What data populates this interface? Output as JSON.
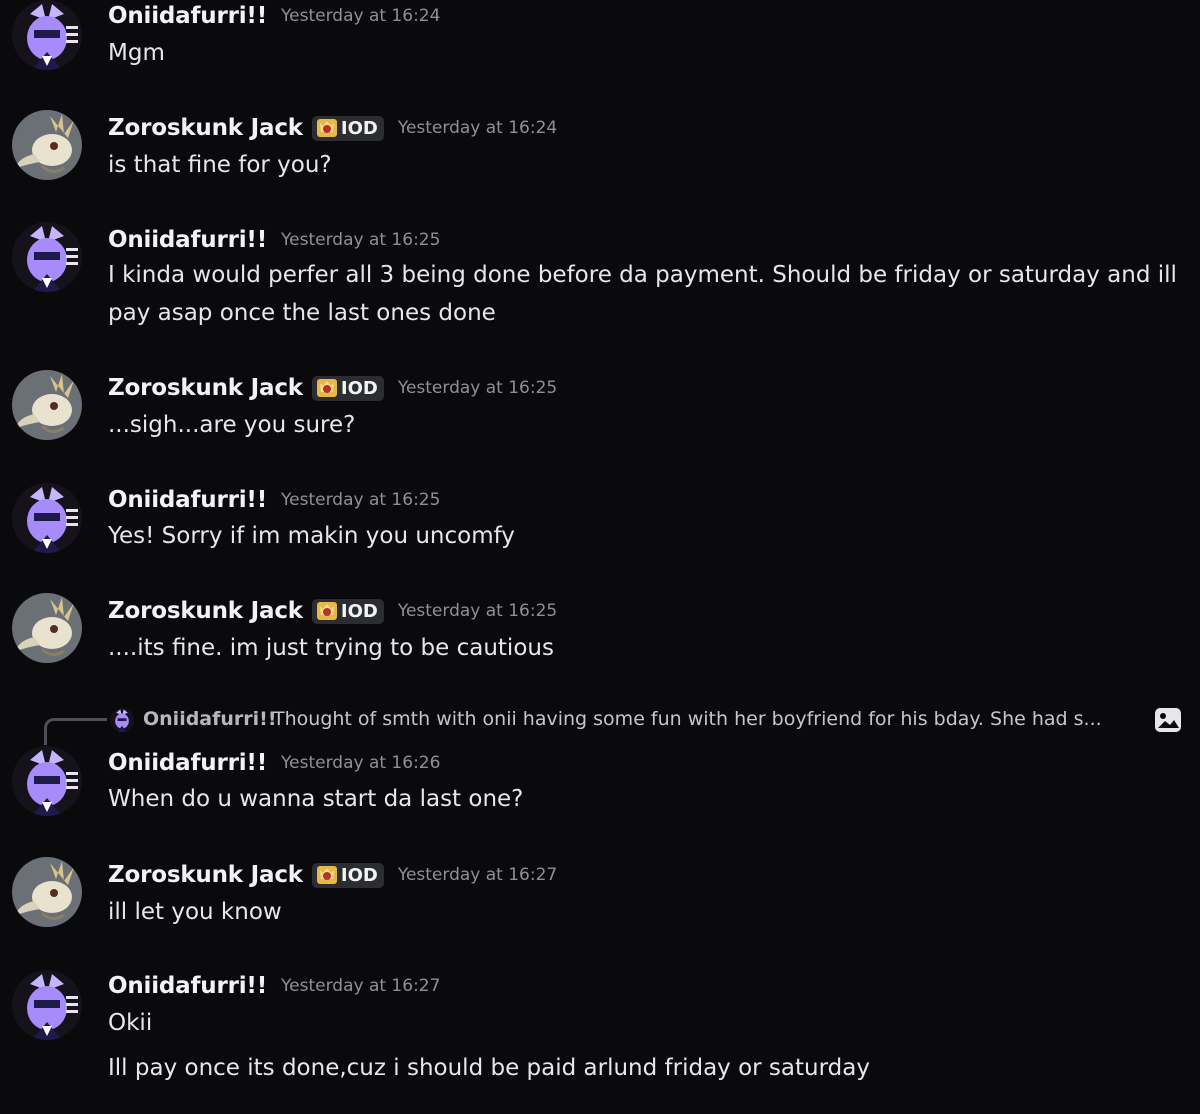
{
  "users": {
    "onii": {
      "name": "Oniidafurri!!"
    },
    "zoro": {
      "name": "Zoroskunk Jack",
      "tag": "IOD"
    }
  },
  "messages": [
    {
      "author": "Oniidafurri!!",
      "time": "Yesterday at 16:24",
      "lines": [
        "Mgm"
      ]
    },
    {
      "author": "Zoroskunk Jack",
      "tag": "IOD",
      "time": "Yesterday at 16:24",
      "lines": [
        "is that fine for you?"
      ]
    },
    {
      "author": "Oniidafurri!!",
      "time": "Yesterday at 16:25",
      "lines": [
        "I kinda would perfer all 3 being done before da payment. Should be friday or saturday and ill pay asap once the last ones done"
      ]
    },
    {
      "author": "Zoroskunk Jack",
      "tag": "IOD",
      "time": "Yesterday at 16:25",
      "lines": [
        "...sigh...are you sure?"
      ]
    },
    {
      "author": "Oniidafurri!!",
      "time": "Yesterday at 16:25",
      "lines": [
        "Yes! Sorry if im makin you uncomfy"
      ]
    },
    {
      "author": "Zoroskunk Jack",
      "tag": "IOD",
      "time": "Yesterday at 16:25",
      "lines": [
        "....its fine. im just trying to be cautious"
      ]
    },
    {
      "author": "Oniidafurri!!",
      "time": "Yesterday at 16:26",
      "lines": [
        "When do u wanna start da last one?"
      ]
    },
    {
      "author": "Zoroskunk Jack",
      "tag": "IOD",
      "time": "Yesterday at 16:27",
      "lines": [
        "ill let you know"
      ]
    },
    {
      "author": "Oniidafurri!!",
      "time": "Yesterday at 16:27",
      "lines": [
        "Okii",
        "Ill pay once its done,cuz i should be paid arlund friday or saturday"
      ]
    }
  ],
  "reply": {
    "author": "Oniidafurri!!",
    "text": "Thought of smth with onii having some fun with her boyfriend for his bday. She had s...",
    "attachment_icon": "image-icon"
  },
  "colors": {
    "background": "#0a0a0c",
    "username": "#f2f3f5",
    "timestamp": "#8e9096",
    "tag_bg": "#2b2d31",
    "onii_avatar": "#a78bfa",
    "zoro_avatar": "#6b6f76"
  },
  "icons": {
    "onii_avatar": "purple-character-avatar-icon",
    "zoro_avatar": "bird-skull-avatar-icon",
    "role_tag": "crown-shield-icon"
  }
}
